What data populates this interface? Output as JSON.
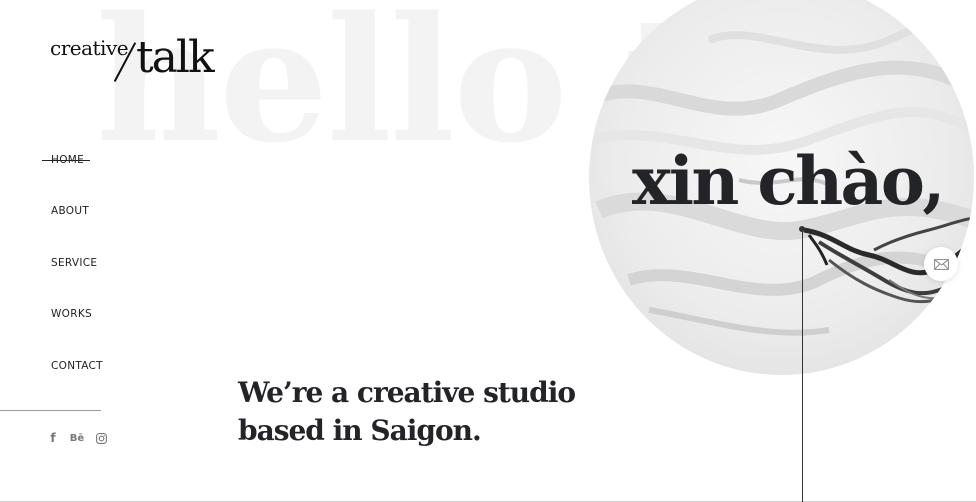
{
  "background": {
    "headline": "hello the",
    "headline_color": "#f3f3f3"
  },
  "logo": {
    "part1": "creative",
    "part2": "talk"
  },
  "nav": {
    "items": [
      {
        "label": "HOME",
        "active": true
      },
      {
        "label": "ABOUT",
        "active": false
      },
      {
        "label": "SERVICE",
        "active": false
      },
      {
        "label": "WORKS",
        "active": false
      },
      {
        "label": "CONTACT",
        "active": false
      }
    ]
  },
  "social": {
    "items": [
      {
        "icon": "facebook-icon",
        "label": "f"
      },
      {
        "icon": "behance-icon",
        "label": "Bē"
      },
      {
        "icon": "instagram-icon",
        "label": ""
      }
    ]
  },
  "hero": {
    "greeting": "xin chào,",
    "tagline_line1": "We’re a creative studio",
    "tagline_line2": "based in Saigon."
  },
  "contact": {
    "icon": "mail-icon"
  },
  "colors": {
    "text_dark": "#222427",
    "accent_line": "#333333"
  }
}
